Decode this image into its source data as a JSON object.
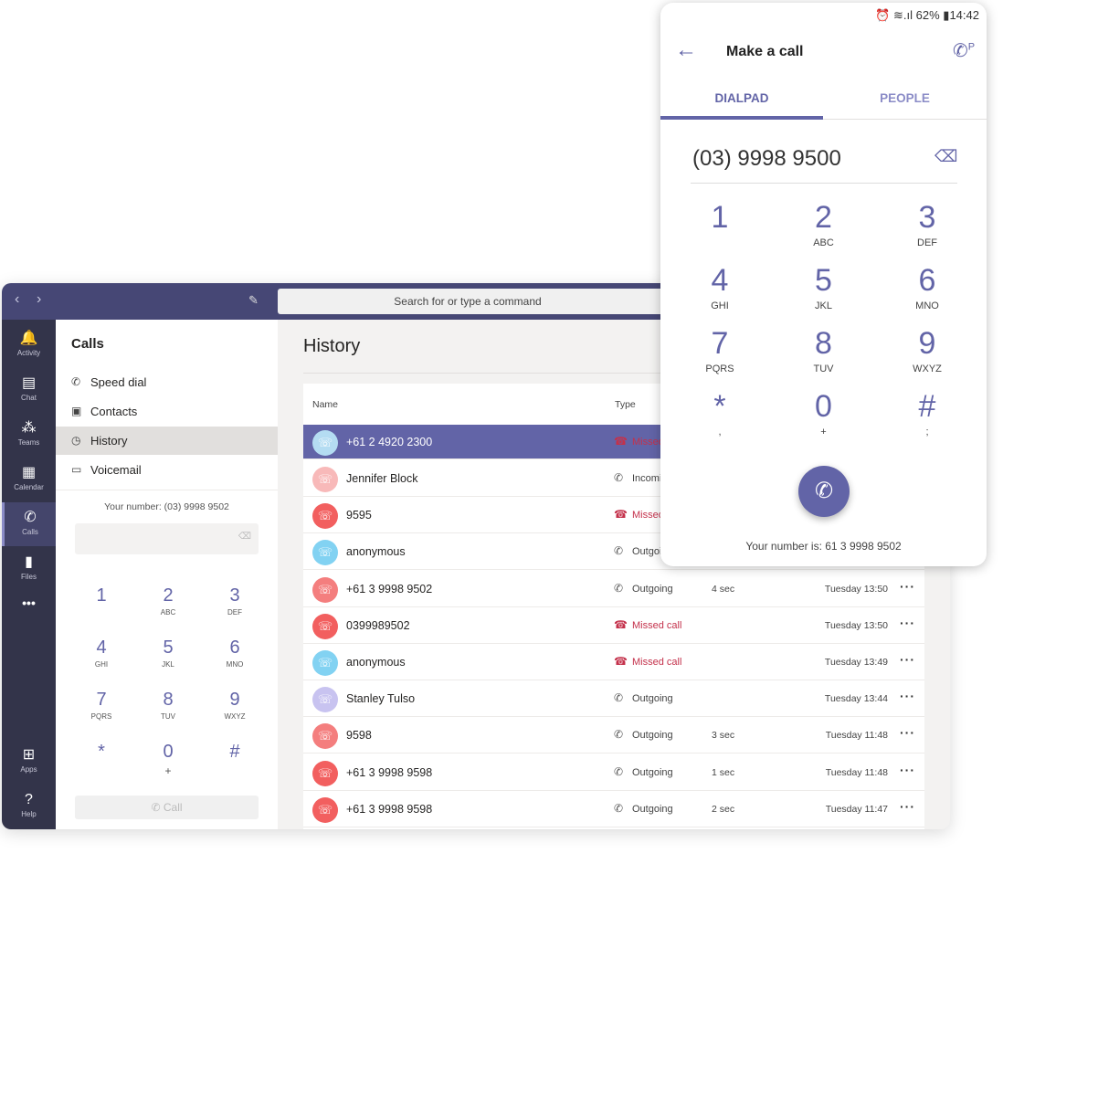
{
  "desktop": {
    "search_placeholder": "Search for or type a command",
    "rail": [
      {
        "label": "Activity",
        "icon": "bell-icon",
        "glyph": "🔔"
      },
      {
        "label": "Chat",
        "icon": "chat-icon",
        "glyph": "▤"
      },
      {
        "label": "Teams",
        "icon": "teams-icon",
        "glyph": "⁂"
      },
      {
        "label": "Calendar",
        "icon": "calendar-icon",
        "glyph": "▦"
      },
      {
        "label": "Calls",
        "icon": "phone-icon",
        "glyph": "✆"
      },
      {
        "label": "Files",
        "icon": "file-icon",
        "glyph": "▮"
      }
    ],
    "rail_bottom": [
      {
        "label": "Apps",
        "icon": "apps-icon",
        "glyph": "⊞"
      },
      {
        "label": "Help",
        "icon": "help-icon",
        "glyph": "?"
      }
    ],
    "panel": {
      "title": "Calls",
      "items": [
        {
          "label": "Speed dial",
          "glyph": "✆"
        },
        {
          "label": "Contacts",
          "glyph": "▣"
        },
        {
          "label": "History",
          "glyph": "◷"
        },
        {
          "label": "Voicemail",
          "glyph": "▭"
        }
      ],
      "your_number": "Your number: (03) 9998 9502",
      "call_label": "Call"
    },
    "keys": [
      {
        "d": "1",
        "l": ""
      },
      {
        "d": "2",
        "l": "ABC"
      },
      {
        "d": "3",
        "l": "DEF"
      },
      {
        "d": "4",
        "l": "GHI"
      },
      {
        "d": "5",
        "l": "JKL"
      },
      {
        "d": "6",
        "l": "MNO"
      },
      {
        "d": "7",
        "l": "PQRS"
      },
      {
        "d": "8",
        "l": "TUV"
      },
      {
        "d": "9",
        "l": "WXYZ"
      },
      {
        "d": "*",
        "l": ""
      },
      {
        "d": "0",
        "l": "+"
      },
      {
        "d": "#",
        "l": ""
      }
    ],
    "history": {
      "title": "History",
      "columns": [
        "Name",
        "Type"
      ],
      "rows": [
        {
          "name": "+61 2 4920 2300",
          "type": "Missed call",
          "missed": true,
          "duration": "",
          "time": "",
          "color": "#b4dcf2",
          "selected": true
        },
        {
          "name": "Jennifer Block",
          "type": "Incoming",
          "missed": false,
          "duration": "",
          "time": "",
          "color": "#f8b9b9"
        },
        {
          "name": "9595",
          "type": "Missed call",
          "missed": true,
          "duration": "",
          "time": "",
          "color": "#f25f5f"
        },
        {
          "name": "anonymous",
          "type": "Outgoing",
          "missed": false,
          "duration": "",
          "time": "",
          "color": "#82d2f2"
        },
        {
          "name": "+61 3 9998 9502",
          "type": "Outgoing",
          "missed": false,
          "duration": "4 sec",
          "time": "Tuesday 13:50",
          "color": "#f47e7e"
        },
        {
          "name": "0399989502",
          "type": "Missed call",
          "missed": true,
          "duration": "",
          "time": "Tuesday 13:50",
          "color": "#f25f5f"
        },
        {
          "name": "anonymous",
          "type": "Missed call",
          "missed": true,
          "duration": "",
          "time": "Tuesday 13:49",
          "color": "#82d2f2"
        },
        {
          "name": "Stanley Tulso",
          "type": "Outgoing",
          "missed": false,
          "duration": "",
          "time": "Tuesday 13:44",
          "color": "#c8c3f0"
        },
        {
          "name": "9598",
          "type": "Outgoing",
          "missed": false,
          "duration": "3 sec",
          "time": "Tuesday 11:48",
          "color": "#f47e7e"
        },
        {
          "name": "+61 3 9998 9598",
          "type": "Outgoing",
          "missed": false,
          "duration": "1 sec",
          "time": "Tuesday 11:48",
          "color": "#f25f5f"
        },
        {
          "name": "+61 3 9998 9598",
          "type": "Outgoing",
          "missed": false,
          "duration": "2 sec",
          "time": "Tuesday 11:47",
          "color": "#f25f5f"
        }
      ]
    }
  },
  "phone": {
    "status": {
      "battery": "62%",
      "time": "14:42"
    },
    "title": "Make a call",
    "tabs": [
      "DIALPAD",
      "PEOPLE"
    ],
    "number": "(03) 9998 9500",
    "keys": [
      {
        "d": "1",
        "l": ""
      },
      {
        "d": "2",
        "l": "ABC"
      },
      {
        "d": "3",
        "l": "DEF"
      },
      {
        "d": "4",
        "l": "GHI"
      },
      {
        "d": "5",
        "l": "JKL"
      },
      {
        "d": "6",
        "l": "MNO"
      },
      {
        "d": "7",
        "l": "PQRS"
      },
      {
        "d": "8",
        "l": "TUV"
      },
      {
        "d": "9",
        "l": "WXYZ"
      },
      {
        "d": "*",
        "l": ","
      },
      {
        "d": "0",
        "l": "+"
      },
      {
        "d": "#",
        "l": ";"
      }
    ],
    "your_number": "Your number is: 61 3 9998 9502",
    "accent": "#6264a7"
  }
}
